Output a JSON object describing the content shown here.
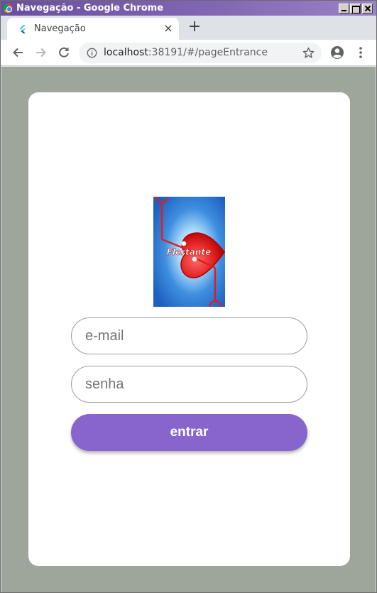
{
  "window": {
    "title": "Navegação - Google Chrome"
  },
  "tab": {
    "title": "Navegação",
    "close_glyph": "×",
    "favicon": "flutter-icon"
  },
  "new_tab_glyph": "+",
  "address_bar": {
    "host": "localhost",
    "rest": ":38191/#/pageEntrance"
  },
  "login": {
    "logo_text": "Flertante",
    "email_placeholder": "e-mail",
    "password_placeholder": "senha",
    "submit_label": "entrar"
  },
  "colors": {
    "titlebar": "#6a4fa0",
    "page_background": "#9ea69b",
    "card": "#ffffff",
    "button": "#8865cc",
    "logo_heart": "#e01e1e",
    "logo_background": "#3f8fe0"
  }
}
